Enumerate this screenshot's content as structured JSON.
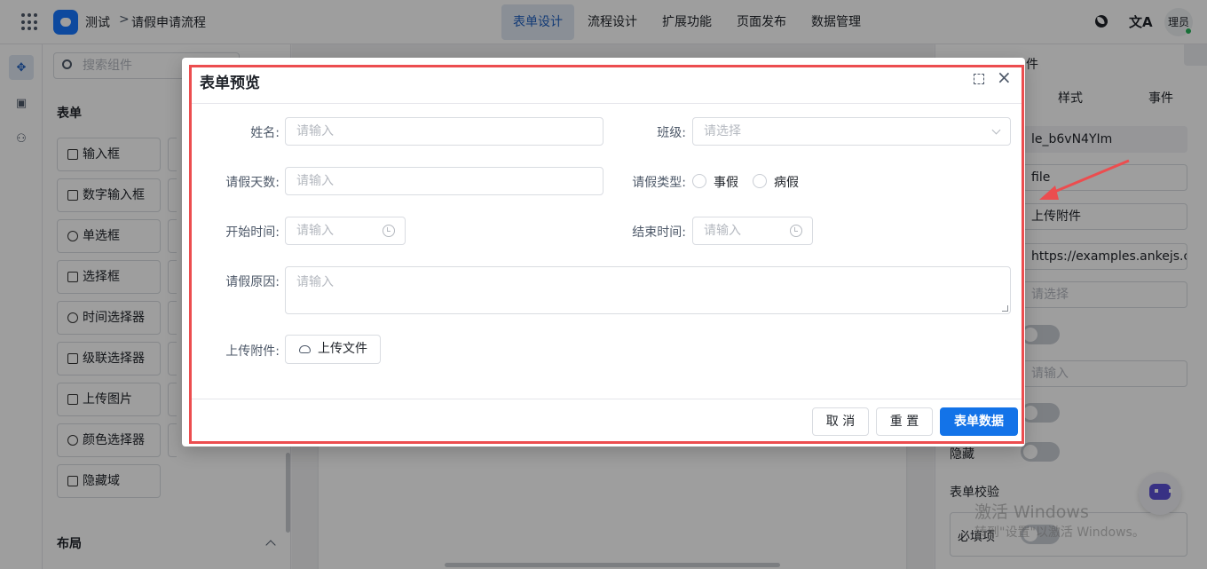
{
  "topbar": {
    "app_name": "测试",
    "breadcrumb_separator": ">",
    "breadcrumb": "请假申请流程",
    "tabs": [
      "表单设计",
      "流程设计",
      "扩展功能",
      "页面发布",
      "数据管理"
    ],
    "active_tab": "表单设计",
    "user": "理员"
  },
  "components": {
    "search_placeholder": "搜索组件",
    "section_form": "表单",
    "items": [
      "输入框",
      "数字输入框",
      "单选框",
      "选择框",
      "时间选择器",
      "级联选择器",
      "上传图片",
      "颜色选择器",
      "隐藏域"
    ],
    "section_layout": "布局"
  },
  "properties": {
    "title_partial": "件",
    "tabs": [
      "样式",
      "事件"
    ],
    "field_id": "le_b6vN4YIm",
    "field_type": "file",
    "field_label": "上传附件",
    "field_url": "https://examples.ankejs.cn,",
    "select_placeholder": "请选择",
    "input_placeholder": "请输入",
    "hidden_label": "隐藏",
    "validation_label": "表单校验",
    "required_label": "必填项"
  },
  "watermark": {
    "line1": "激活 Windows",
    "line2": "转到\"设置\"以激活 Windows。"
  },
  "modal": {
    "title": "表单预览",
    "fields": {
      "name_label": "姓名:",
      "name_placeholder": "请输入",
      "class_label": "班级:",
      "class_placeholder": "请选择",
      "days_label": "请假天数:",
      "days_placeholder": "请输入",
      "type_label": "请假类型:",
      "type_options": [
        "事假",
        "病假"
      ],
      "start_label": "开始时间:",
      "start_placeholder": "请输入",
      "end_label": "结束时间:",
      "end_placeholder": "请输入",
      "reason_label": "请假原因:",
      "reason_placeholder": "请输入",
      "attach_label": "上传附件:",
      "upload_button": "上传文件"
    },
    "buttons": {
      "cancel": "取 消",
      "reset": "重 置",
      "submit": "表单数据"
    }
  },
  "colors": {
    "primary": "#1373e8",
    "highlight_outline": "#ec4d4f",
    "annotation_arrow": "#ec4d4f"
  }
}
